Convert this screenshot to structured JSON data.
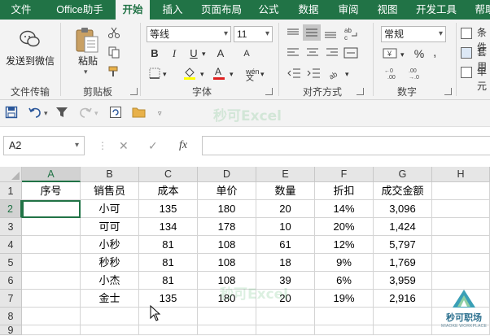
{
  "menu_tabs": [
    {
      "label": "文件",
      "active": false
    },
    {
      "label": "Office助手",
      "active": false
    },
    {
      "label": "开始",
      "active": true
    },
    {
      "label": "插入",
      "active": false
    },
    {
      "label": "页面布局",
      "active": false
    },
    {
      "label": "公式",
      "active": false
    },
    {
      "label": "数据",
      "active": false
    },
    {
      "label": "审阅",
      "active": false
    },
    {
      "label": "视图",
      "active": false
    },
    {
      "label": "开发工具",
      "active": false
    },
    {
      "label": "帮助",
      "active": false
    }
  ],
  "ribbon": {
    "wechat_label": "发送到微信",
    "group_file_transfer": "文件传输",
    "paste_label": "粘贴",
    "group_clipboard": "剪贴板",
    "font_name": "等线",
    "font_size": "11",
    "bold": "B",
    "italic": "I",
    "underline": "U",
    "font_size_up": "A",
    "font_size_down": "A",
    "phonetic": "wén",
    "group_font": "字体",
    "group_alignment": "对齐方式",
    "number_format": "常规",
    "percent": "%",
    "group_number": "数字",
    "cond_format_label": "条件",
    "table_format_label": "套用",
    "cell_style_label": "单元"
  },
  "watermark_top": "秒可Excel",
  "watermark_grid": "秒可Excel",
  "name_box": "A2",
  "formula_fx": "fx",
  "formula_value": "",
  "columns": [
    "A",
    "B",
    "C",
    "D",
    "E",
    "F",
    "G",
    "H"
  ],
  "rows": [
    "1",
    "2",
    "3",
    "4",
    "5",
    "6",
    "7",
    "8",
    "9"
  ],
  "table": {
    "headers": [
      "序号",
      "销售员",
      "成本",
      "单价",
      "数量",
      "折扣",
      "成交金额"
    ],
    "data": [
      [
        "",
        "小可",
        "135",
        "180",
        "20",
        "14%",
        "3,096"
      ],
      [
        "",
        "可可",
        "134",
        "178",
        "10",
        "20%",
        "1,424"
      ],
      [
        "",
        "小秒",
        "81",
        "108",
        "61",
        "12%",
        "5,797"
      ],
      [
        "",
        "秒秒",
        "81",
        "108",
        "18",
        "9%",
        "1,769"
      ],
      [
        "",
        "小杰",
        "81",
        "108",
        "39",
        "6%",
        "3,959"
      ],
      [
        "",
        "金士",
        "135",
        "180",
        "20",
        "19%",
        "2,916"
      ]
    ]
  },
  "logo_text": "秒可职场",
  "logo_sub": "MIAOKE WORKPLACE",
  "colors": {
    "accent": "#217346",
    "ribbon_bg": "#f3f3f3"
  }
}
